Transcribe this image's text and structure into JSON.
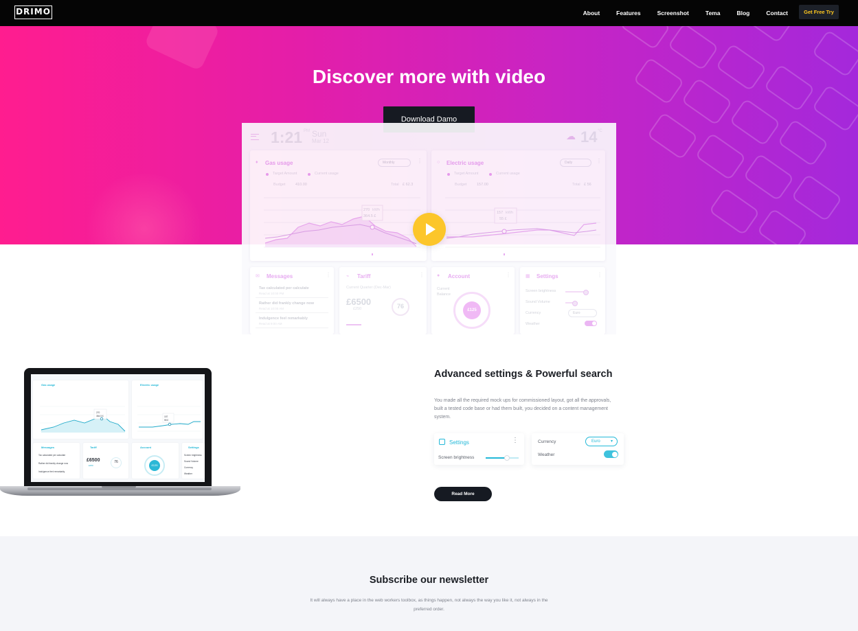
{
  "brand": {
    "logo": "DRIMO"
  },
  "nav": {
    "links": [
      "About",
      "Features",
      "Screenshot",
      "Tema",
      "Blog",
      "Contact"
    ],
    "cta": "Get Free Try"
  },
  "hero": {
    "title": "Discover more with video",
    "button": "Download Damo"
  },
  "preview": {
    "time": "1:21",
    "ampm": "PM",
    "day": "Sun",
    "date": "Mar 12",
    "temp": "14",
    "deg": "°C",
    "gas": {
      "title": "Gas usage",
      "select": "Monthly",
      "legend_target": "Target Amount",
      "legend_current": "Current usage",
      "budget_label": "Budget",
      "budget_value": "410.00",
      "total_label": "Total",
      "total_value": "£ 62.3",
      "tip_top": "270",
      "tip_top_unit": "kWh",
      "tip_bottom": "364.5 £",
      "months": [
        "Jan",
        "Feb",
        "Mar",
        "Apr",
        "May",
        "Jun",
        "Jul",
        "Aug",
        "Sep",
        "Oct",
        "Nov",
        "Dec"
      ],
      "active_month": "Aug",
      "y_ticks": [
        "400",
        "300",
        "200",
        "100",
        "0"
      ]
    },
    "electric": {
      "title": "Electric usage",
      "select": "Daily",
      "legend_target": "Target Amount",
      "legend_current": "Current usage",
      "budget_label": "Budget",
      "budget_value": "157.00",
      "total_label": "Total",
      "total_value": "£ 56",
      "tip_top": "157",
      "tip_top_unit": "kWh",
      "tip_bottom": "55 £",
      "months": [
        "Jan",
        "Feb",
        "Mar",
        "Apr",
        "May",
        "Jun",
        "Jul",
        "Aug",
        "Sep",
        "Oct",
        "Nov",
        "Dec"
      ],
      "active_month": "May",
      "y_ticks": [
        "400",
        "300",
        "200",
        "100",
        "0"
      ]
    },
    "messages": {
      "title": "Messages",
      "items": [
        {
          "title": "Tax calculated per calculate",
          "sub": "Read at 10:00 PM"
        },
        {
          "title": "Rather did frankly change now",
          "sub": "Read at 10:00 AM"
        },
        {
          "title": "Indulgence feel remarkably",
          "sub": "Read at 9:00 AM"
        }
      ]
    },
    "tariff": {
      "title": "Tariff",
      "period": "Current Quarter (Dec-Mar)",
      "amount": "£6500",
      "sub_amount": "£250",
      "gauge": "76",
      "gauge_unit": "kWh"
    },
    "account": {
      "title": "Account",
      "label1": "Current",
      "label2": "Balance",
      "value": "£125"
    },
    "settings": {
      "title": "Settings",
      "rows": [
        "Screen brightness",
        "Sound Volume",
        "Currency",
        "Weather"
      ],
      "currency": "Euro"
    }
  },
  "laptop_screen": {
    "gas_title": "Gas usage",
    "electric_title": "Electric usage",
    "messages_title": "Messages",
    "tariff_title": "Tariff",
    "account_title": "Account",
    "settings_title": "Settings",
    "tariff_amount": "£6500",
    "tariff_sub": "£250",
    "gauge": "76",
    "balance": "£125",
    "msg1": "Tax calculated per calculate",
    "msg2": "Rather did frankly change now",
    "msg3": "Indulgence feel remarkably",
    "settings_rows": [
      "Screen brightness",
      "Sound Volume",
      "Currency",
      "Weather"
    ],
    "tip_gas_top": "270",
    "tip_gas_bottom": "364.5 £",
    "tip_el_top": "157",
    "tip_el_bottom": "55 £"
  },
  "feature": {
    "title": "Advanced settings & Powerful search",
    "description": "You made all the required mock ups for commissioned layout, got all the approvals, built a tested code base or had them built, you decided on a content management system.",
    "settings_title": "Settings",
    "brightness_label": "Screen brightness",
    "brightness_level": 0.65,
    "currency_label": "Currency",
    "currency_value": "Euro",
    "weather_label": "Weather",
    "weather_on": true,
    "button": "Read More"
  },
  "newsletter": {
    "title": "Subscribe our newsletter",
    "text": "It will always have a place in the web workers toolbox, as things happen, not always the way you like it, not always in the preferred order."
  },
  "colors": {
    "hero_start": "#ff1d8f",
    "hero_end": "#a428db",
    "dark": "#161a22",
    "accent_yellow": "#fcc62a",
    "accent_cyan": "#22b8d8"
  }
}
